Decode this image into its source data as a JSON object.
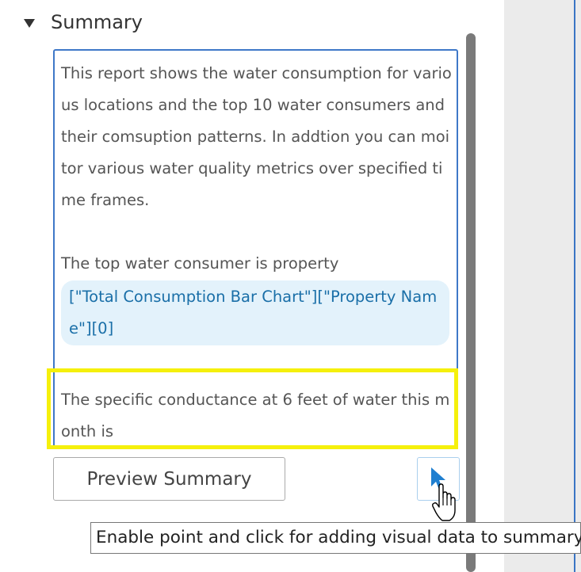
{
  "section": {
    "title": "Summary"
  },
  "editor": {
    "paragraph1": "This report shows the water consumption for various locations and the top 10 water consumers and their comsuption patterns. In addtion you can moitor various water quality metrics over specified time frames.",
    "paragraph2": "The top water consumer is property",
    "token": "[\"Total Consumption Bar Chart\"][\"Property Name\"][0]",
    "paragraph3": "The specific conductance at 6 feet of water this month is"
  },
  "buttons": {
    "preview_label": "Preview Summary"
  },
  "tooltip": {
    "text": "Enable point and click for adding visual data to summary"
  },
  "icons": {
    "collapse": "triangle-down-icon",
    "point_click": "arrow-cursor-icon",
    "pointer": "hand-cursor-icon"
  },
  "colors": {
    "accent": "#3f78c8",
    "highlight": "#f5f00c",
    "token_bg": "#e3f2fb",
    "token_text": "#1a6fa8"
  }
}
